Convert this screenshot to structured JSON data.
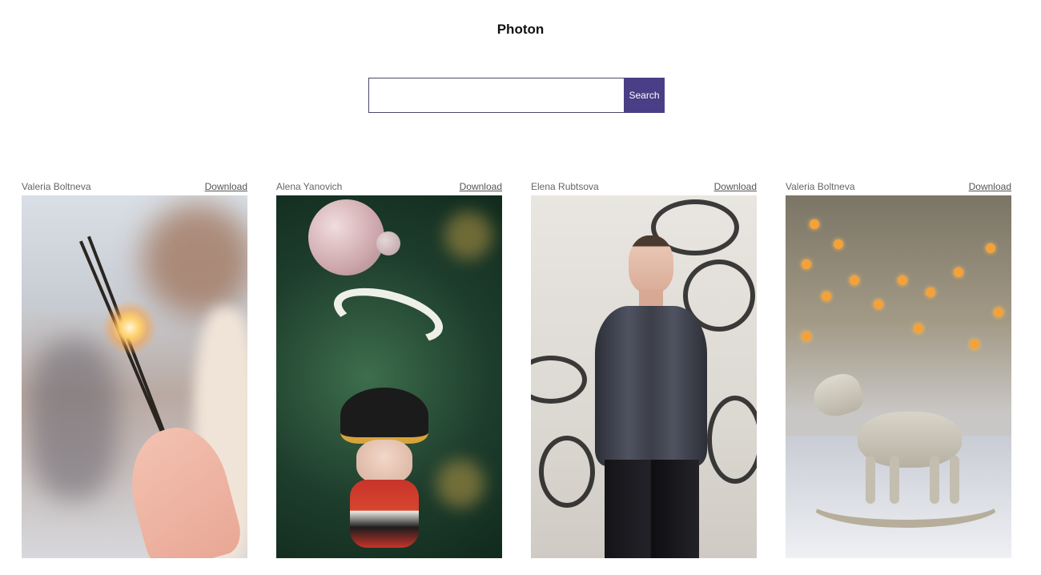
{
  "header": {
    "title": "Photon"
  },
  "search": {
    "value": "",
    "placeholder": "",
    "button_label": "Search"
  },
  "photos": [
    {
      "author": "Valeria Boltneva",
      "download_label": "Download",
      "subject": "sparklers"
    },
    {
      "author": "Alena Yanovich",
      "download_label": "Download",
      "subject": "ornament"
    },
    {
      "author": "Elena Rubtsova",
      "download_label": "Download",
      "subject": "person"
    },
    {
      "author": "Valeria Boltneva",
      "download_label": "Download",
      "subject": "rocking-horse"
    }
  ],
  "colors": {
    "search_button": "#4a3f86",
    "text": "#222222"
  }
}
